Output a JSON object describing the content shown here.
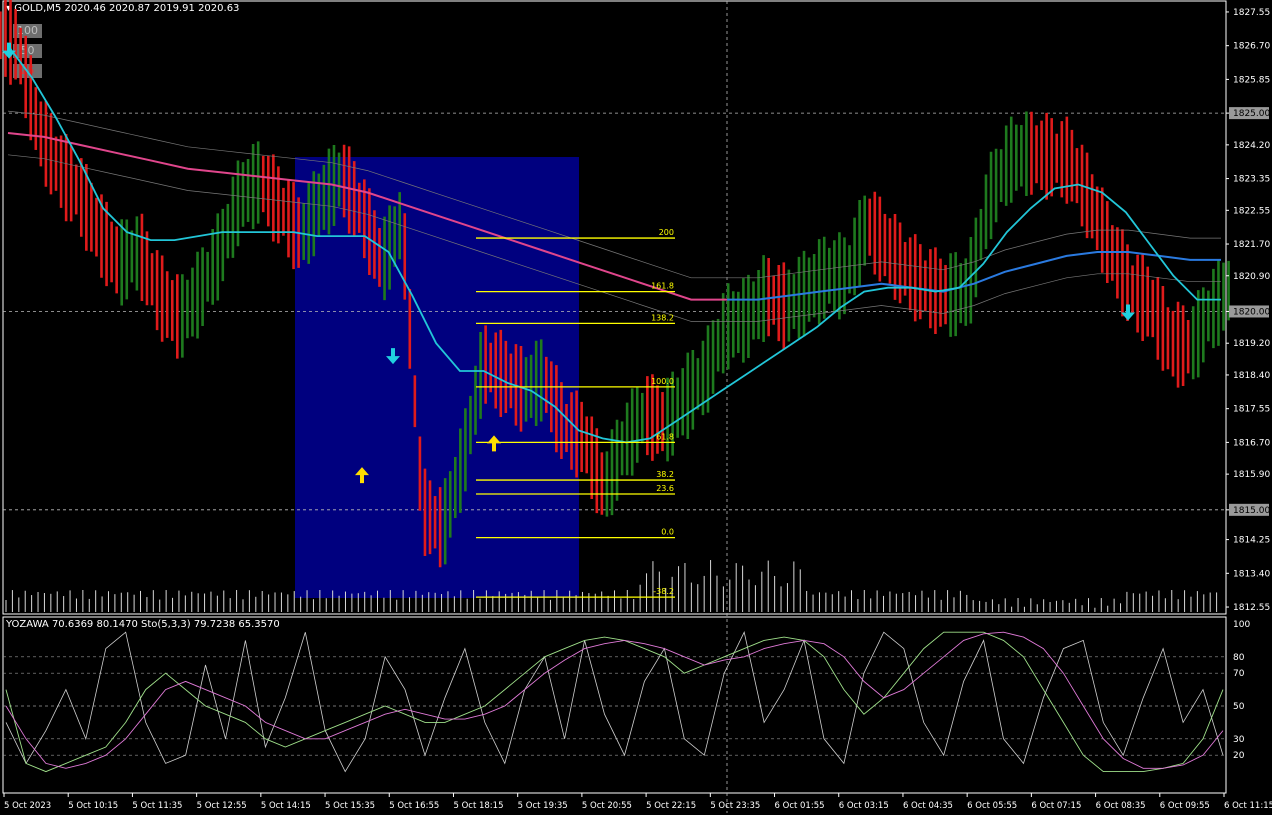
{
  "window": {
    "symbol_label": "GOLD,M5",
    "ohlc": "2020.46 2020.87 2019.91 2020.63",
    "indicator_label": "YOZAWA 70.6369 80.1470",
    "stochastic_label": "Sto(5,3,3) 79.7238 65.3570"
  },
  "level_buttons": [
    "100",
    "50",
    "25"
  ],
  "colors": {
    "background": "#000000",
    "bull_bar": "#1e7a1e",
    "bear_bar": "#e01b1b",
    "ma_fast": "#22c6d8",
    "ma_slow_pink": "#e0468c",
    "ma_slow_blue": "#2a7ae0",
    "fib_box": "#00007f",
    "fib_line": "#ffff00",
    "signal_up": "#ffdd00",
    "signal_down": "#20d0e0"
  },
  "chart_data": [
    {
      "type": "line",
      "title": "GOLD,M5",
      "y_ticks": [
        "1827.55",
        "1826.70",
        "1825.85",
        "1825.00",
        "1824.20",
        "1823.35",
        "1822.55",
        "1821.70",
        "1820.90",
        "1820.00",
        "1819.20",
        "1818.40",
        "1817.55",
        "1816.70",
        "1815.90",
        "1815.00",
        "1814.25",
        "1813.40",
        "1812.55"
      ],
      "ylim": [
        1812.45,
        1827.7
      ],
      "highlight_levels": [
        "1825.00",
        "1820.00",
        "1815.00"
      ],
      "x_ticks": [
        "5 Oct 2023",
        "5 Oct 10:15",
        "5 Oct 11:35",
        "5 Oct 12:55",
        "5 Oct 14:15",
        "5 Oct 15:35",
        "5 Oct 16:55",
        "5 Oct 18:15",
        "5 Oct 19:35",
        "5 Oct 20:55",
        "5 Oct 22:15",
        "5 Oct 23:35",
        "6 Oct 01:55",
        "6 Oct 03:15",
        "6 Oct 04:35",
        "6 Oct 05:55",
        "6 Oct 07:15",
        "6 Oct 08:35",
        "6 Oct 09:55",
        "6 Oct 11:15"
      ],
      "series": [
        {
          "name": "",
          "kind": "close",
          "values": [
            1826.7,
            1824.6,
            1823.6,
            1823.0,
            1822.0,
            1821.2,
            1821.5,
            1820.4,
            1819.8,
            1820.5,
            1821.5,
            1822.9,
            1823.3,
            1822.6,
            1821.9,
            1822.8,
            1823.4,
            1822.5,
            1821.2,
            1822.3,
            1815.0,
            1814.5,
            1816.2,
            1818.7,
            1818.4,
            1818.0,
            1818.3,
            1817.1,
            1816.8,
            1815.5,
            1816.7,
            1817.4,
            1817.2,
            1817.8,
            1818.4,
            1819.6,
            1819.8,
            1820.4,
            1820.1,
            1820.5,
            1820.9,
            1820.9,
            1822.2,
            1821.6,
            1821.0,
            1820.6,
            1820.4,
            1820.5,
            1822.8,
            1823.8,
            1824.0,
            1823.9,
            1823.8,
            1822.8,
            1821.6,
            1820.6,
            1820.2,
            1819.2,
            1819.1,
            1820.0,
            1820.6
          ]
        },
        {
          "name": "",
          "kind": "fast_ma",
          "values": [
            1826.7,
            1825.9,
            1824.9,
            1823.8,
            1822.6,
            1822.0,
            1821.8,
            1821.8,
            1821.9,
            1822.0,
            1822.0,
            1822.0,
            1822.0,
            1821.9,
            1821.9,
            1821.9,
            1821.5,
            1820.4,
            1819.2,
            1818.5,
            1818.5,
            1818.2,
            1818.0,
            1817.6,
            1817.0,
            1816.8,
            1816.7,
            1816.8,
            1817.2,
            1817.6,
            1818.0,
            1818.4,
            1818.8,
            1819.2,
            1819.6,
            1820.1,
            1820.5,
            1820.6,
            1820.6,
            1820.5,
            1820.6,
            1821.2,
            1822.0,
            1822.6,
            1823.1,
            1823.2,
            1823.0,
            1822.5,
            1821.7,
            1820.9,
            1820.3,
            1820.3
          ]
        },
        {
          "name": "",
          "kind": "slow_ma_pink",
          "values": [
            1824.5,
            1824.4,
            1824.2,
            1824.0,
            1823.8,
            1823.6,
            1823.5,
            1823.4,
            1823.3,
            1823.2,
            1823.0,
            1822.7,
            1822.4,
            1822.1,
            1821.8,
            1821.5,
            1821.2,
            1820.9,
            1820.6,
            1820.3,
            1820.3
          ]
        },
        {
          "name": "",
          "kind": "slow_ma_blue",
          "values": [
            1820.3,
            1820.3,
            1820.4,
            1820.5,
            1820.6,
            1820.7,
            1820.6,
            1820.5,
            1820.7,
            1821.0,
            1821.2,
            1821.4,
            1821.5,
            1821.5,
            1821.4,
            1821.3,
            1821.3
          ]
        }
      ],
      "fibonacci": {
        "levels": [
          "200",
          "161.8",
          "138.2",
          "100.0",
          "61.8",
          "38.2",
          "23.6",
          "0.0",
          "-38.2"
        ],
        "prices": [
          1821.85,
          1820.5,
          1819.7,
          1818.1,
          1816.7,
          1815.75,
          1815.4,
          1814.3,
          1812.8
        ]
      },
      "signals": [
        {
          "type": "up",
          "price": 1815.85
        },
        {
          "type": "down",
          "price": 1818.9
        },
        {
          "type": "up",
          "price": 1816.65
        },
        {
          "type": "down",
          "price": 1820.0
        },
        {
          "type": "down",
          "price": 1826.6
        }
      ],
      "volume_scale": "relative"
    },
    {
      "type": "line",
      "title": "YOZAWA",
      "y_ticks": [
        "100",
        "80",
        "70",
        "50",
        "30",
        "20"
      ],
      "ylim": [
        0,
        100
      ],
      "series": [
        {
          "name": "",
          "kind": "fast",
          "values": [
            40,
            15,
            35,
            60,
            30,
            85,
            95,
            40,
            15,
            20,
            75,
            30,
            90,
            25,
            55,
            95,
            35,
            10,
            30,
            80,
            60,
            20,
            55,
            85,
            40,
            15,
            60,
            80,
            30,
            90,
            45,
            20,
            65,
            85,
            30,
            20,
            70,
            95,
            40,
            60,
            90,
            30,
            15,
            70,
            95,
            85,
            40,
            20,
            65,
            90,
            30,
            15,
            55,
            85,
            90,
            40,
            20,
            55,
            85,
            40,
            60,
            20
          ]
        },
        {
          "name": "",
          "kind": "stoch_main",
          "values": [
            60,
            15,
            10,
            15,
            20,
            25,
            40,
            60,
            70,
            60,
            50,
            45,
            40,
            30,
            25,
            30,
            35,
            40,
            45,
            50,
            45,
            40,
            40,
            45,
            50,
            60,
            70,
            80,
            85,
            90,
            92,
            90,
            85,
            80,
            70,
            75,
            80,
            85,
            90,
            92,
            90,
            80,
            60,
            45,
            55,
            70,
            85,
            95,
            95,
            95,
            90,
            80,
            60,
            40,
            20,
            10,
            10,
            10,
            12,
            15,
            30,
            60
          ]
        },
        {
          "name": "",
          "kind": "stoch_signal",
          "values": [
            50,
            30,
            15,
            12,
            15,
            20,
            30,
            45,
            60,
            65,
            60,
            55,
            50,
            40,
            35,
            30,
            30,
            35,
            40,
            45,
            48,
            45,
            42,
            42,
            45,
            50,
            60,
            70,
            78,
            85,
            88,
            90,
            88,
            85,
            80,
            75,
            78,
            80,
            85,
            88,
            90,
            88,
            80,
            65,
            55,
            60,
            70,
            80,
            90,
            94,
            95,
            92,
            85,
            70,
            50,
            30,
            18,
            12,
            12,
            14,
            20,
            35
          ]
        }
      ]
    }
  ]
}
